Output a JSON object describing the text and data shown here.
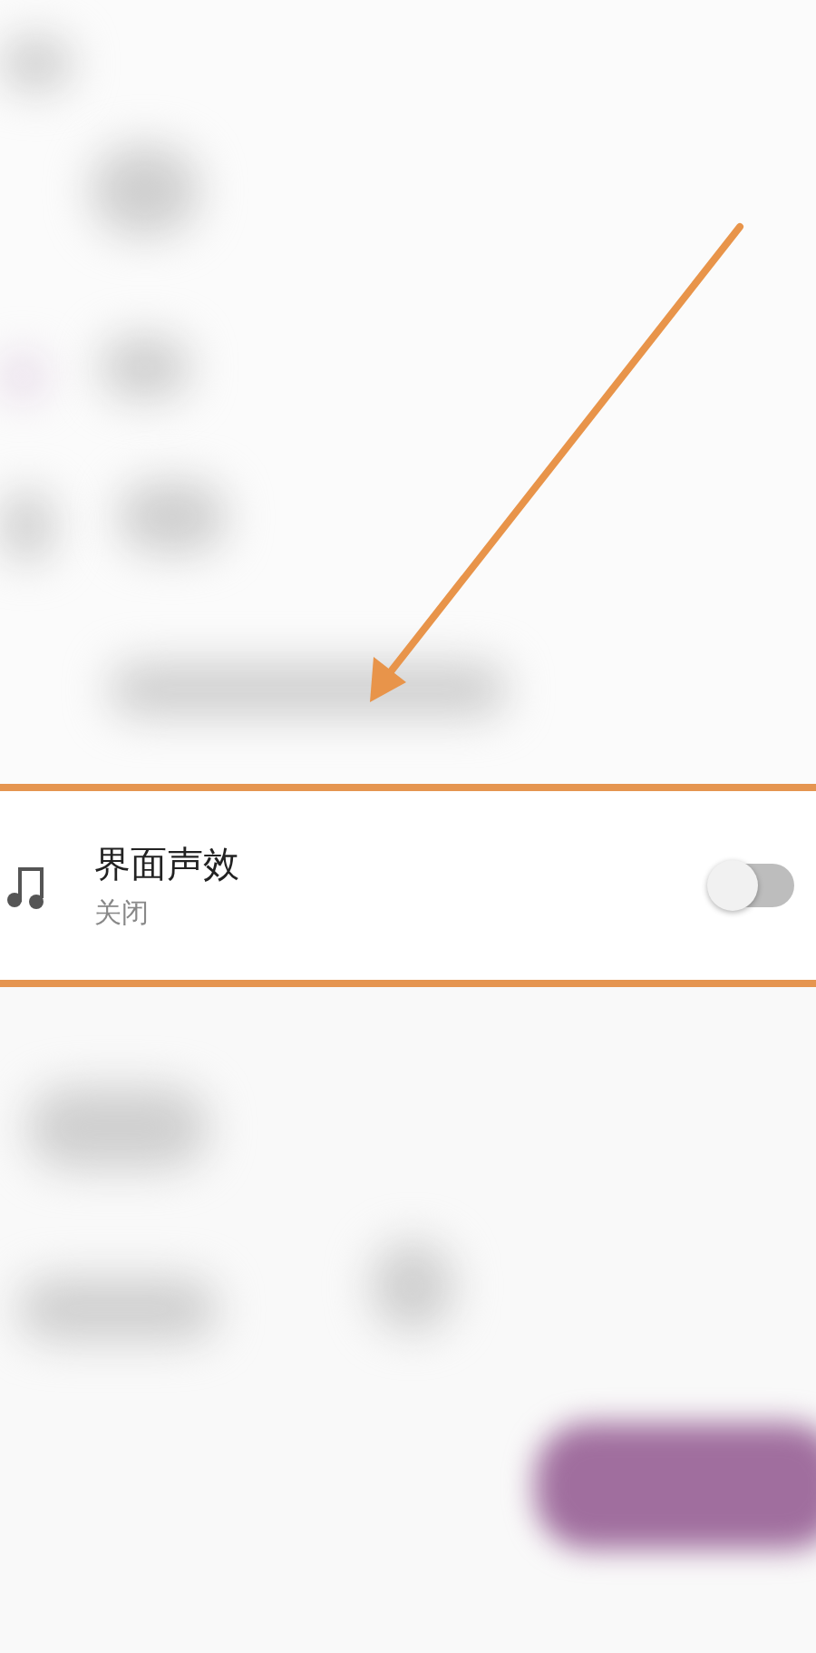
{
  "setting": {
    "title": "界面声效",
    "subtitle": "关闭",
    "on": false
  }
}
